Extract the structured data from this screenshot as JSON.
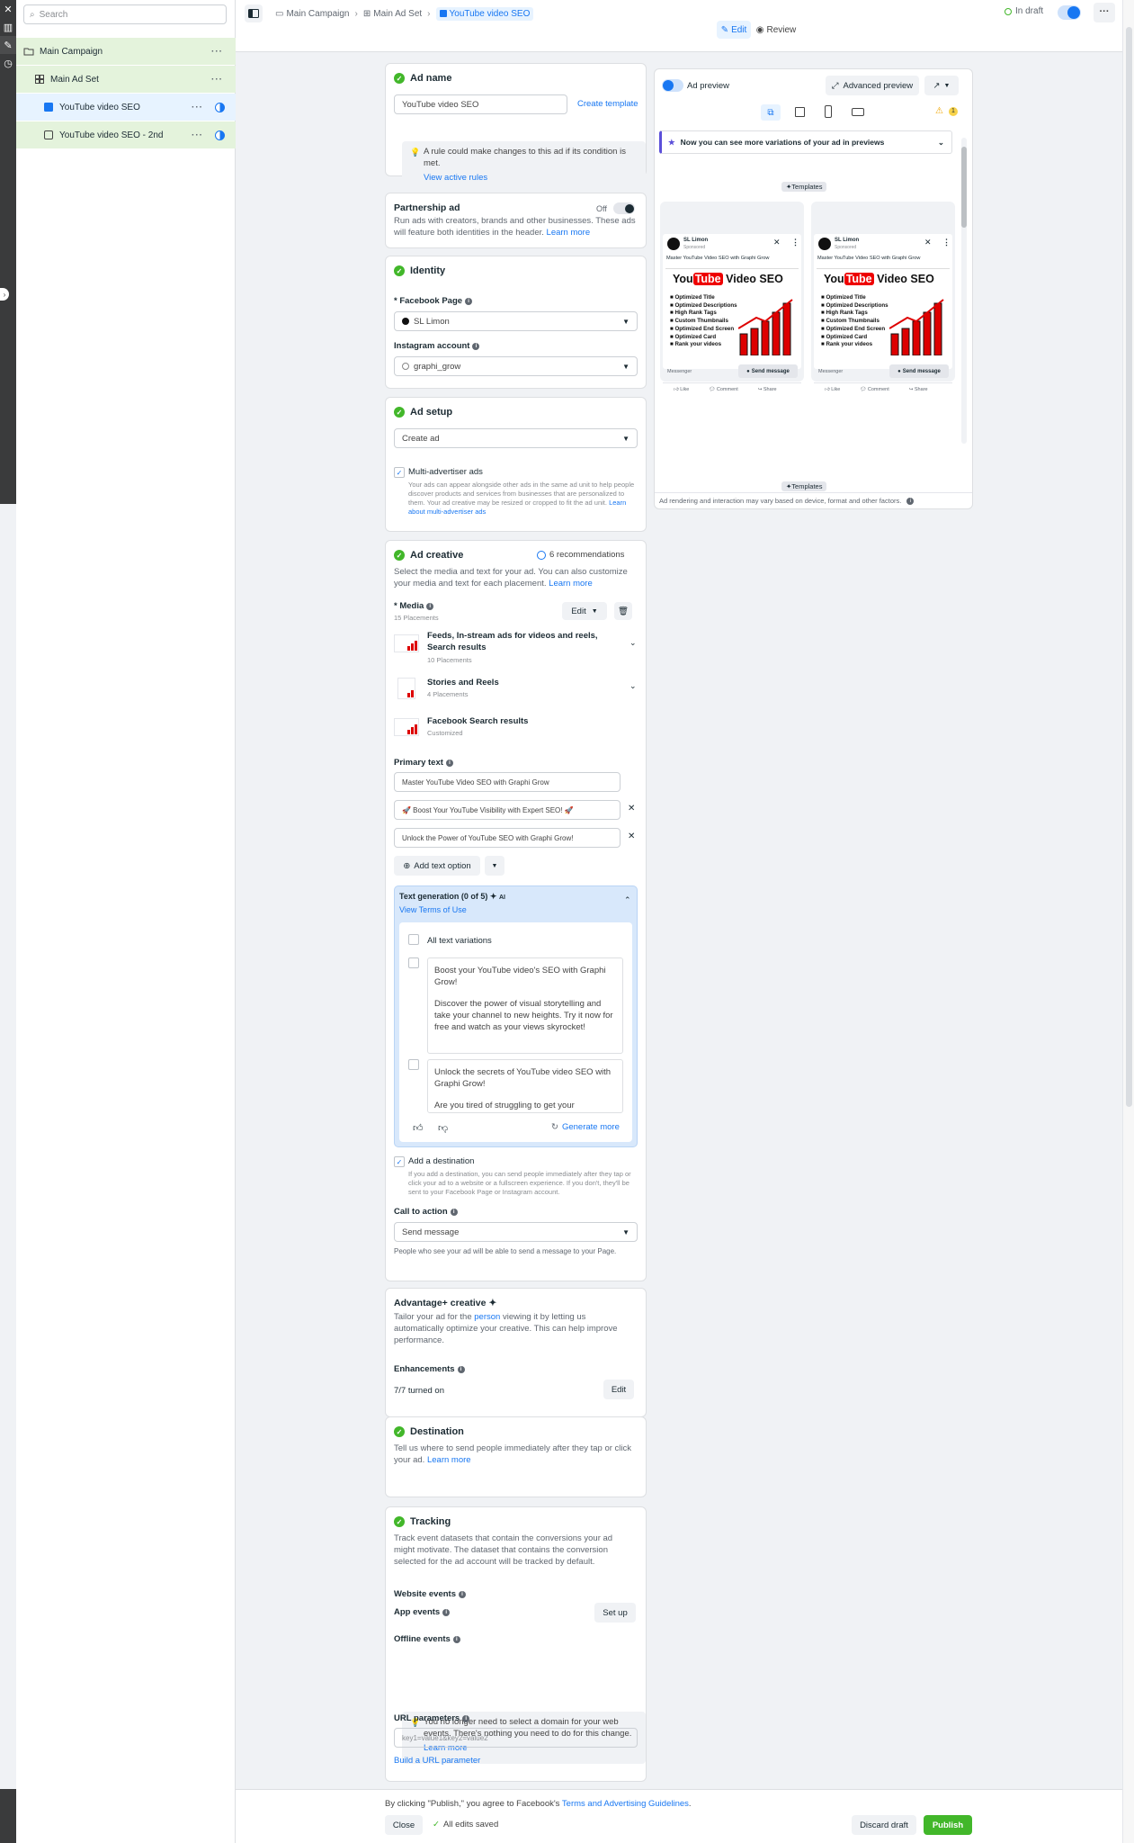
{
  "app": {
    "search_placeholder": "Search"
  },
  "tree": {
    "campaign": "Main Campaign",
    "adset": "Main Ad Set",
    "ad1": "YouTube video SEO",
    "ad2": "YouTube video SEO - 2nd"
  },
  "breadcrumb": {
    "campaign": "Main Campaign",
    "adset": "Main Ad Set",
    "ad": "YouTube video SEO"
  },
  "topbar": {
    "status": "In draft",
    "edit": "Edit",
    "review": "Review"
  },
  "ad_name": {
    "title": "Ad name",
    "value": "YouTube video SEO",
    "create_template": "Create template",
    "rule_note": "A rule could make changes to this ad if its condition is met.",
    "view_rules": "View active rules"
  },
  "partnership": {
    "title": "Partnership ad",
    "toggle": "Off",
    "desc": "Run ads with creators, brands and other businesses. These ads will feature both identities in the header.",
    "learn": "Learn more"
  },
  "identity": {
    "title": "Identity",
    "fb_label": "* Facebook Page",
    "fb_value": "SL Limon",
    "ig_label": "Instagram account",
    "ig_value": "graphi_grow"
  },
  "ad_setup": {
    "title": "Ad setup",
    "select": "Create ad",
    "multi_label": "Multi-advertiser ads",
    "multi_desc": "Your ads can appear alongside other ads in the same ad unit to help people discover products and services from businesses that are personalized to them. Your ad creative may be resized or cropped to fit the ad unit.",
    "multi_link": "Learn about multi-advertiser ads"
  },
  "creative": {
    "title": "Ad creative",
    "recs": "6 recommendations",
    "desc": "Select the media and text for your ad. You can also customize your media and text for each placement.",
    "learn": "Learn more",
    "media_label": "* Media",
    "media_count": "15 Placements",
    "edit": "Edit",
    "placements": [
      {
        "name": "Feeds, In-stream ads for videos and reels, Search results",
        "sub": "10 Placements"
      },
      {
        "name": "Stories and Reels",
        "sub": "4 Placements"
      },
      {
        "name": "Facebook Search results",
        "sub": "Customized"
      }
    ],
    "primary_label": "Primary text",
    "primary_texts": [
      "Master YouTube Video SEO with Graphi Grow",
      "🚀 Boost Your YouTube Visibility with Expert SEO! 🚀",
      "Unlock the Power of YouTube SEO with Graphi Grow!"
    ],
    "add_text": "Add text option",
    "gen_title": "Text generation (0 of 5)",
    "gen_ai": "AI",
    "gen_terms": "View Terms of Use",
    "all_variations": "All text variations",
    "variation1_a": "Boost your YouTube video's SEO with Graphi Grow!",
    "variation1_b": "Discover the power of visual storytelling and take your channel to new heights. Try it now for free and watch as your views skyrocket!",
    "variation2_a": "Unlock the secrets of YouTube video SEO with Graphi Grow!",
    "variation2_b": "Are you tired of struggling to get your",
    "generate": "Generate more",
    "dest_label": "Add a destination",
    "dest_desc": "If you add a destination, you can send people immediately after they tap or click your ad to a website or a fullscreen experience. If you don't, they'll be sent to your Facebook Page or Instagram account.",
    "cta_label": "Call to action",
    "cta_value": "Send message",
    "cta_note": "People who see your ad will be able to send a message to your Page."
  },
  "advantage": {
    "title": "Advantage+ creative",
    "desc_a": "Tailor your ad for the",
    "desc_link": "person",
    "desc_b": "viewing it by letting us automatically optimize your creative. This can help improve performance.",
    "enh_label": "Enhancements",
    "enh_value": "7/7 turned on",
    "edit": "Edit"
  },
  "destination": {
    "title": "Destination",
    "desc": "Tell us where to send people immediately after they tap or click your ad.",
    "learn": "Learn more"
  },
  "tracking": {
    "title": "Tracking",
    "desc": "Track event datasets that contain the conversions your ad might motivate. The dataset that contains the conversion selected for the ad account will be tracked by default.",
    "website": "Website events",
    "app": "App events",
    "setup": "Set up",
    "offline": "Offline events",
    "note": "You no longer need to select a domain for your web events. There's nothing you need to do for this change.",
    "learn": "Learn more",
    "url_label": "URL parameters",
    "url_placeholder": "key1=value1&key2=value2",
    "build": "Build a URL parameter"
  },
  "preview": {
    "label": "Ad preview",
    "advanced": "Advanced preview",
    "warn_count": "1",
    "banner": "Now you can see more variations of your ad in previews",
    "templates": "Templates",
    "templates2": "Templates",
    "disclaimer": "Ad rendering and interaction may vary based on device, format and other factors.",
    "page": "SL Limon",
    "sponsored": "Sponsored",
    "post_text": "Master YouTube Video SEO with Graphi Grow",
    "creative_you": "You",
    "creative_tube": "Tube",
    "creative_rest": "Video SEO",
    "bullets": [
      "Optimized Title",
      "Optimized Descriptions",
      "High Rank Tags",
      "Custom Thumbnails",
      "Optimized End Screen",
      "Optimized Card",
      "Rank your videos"
    ],
    "messenger": "Messenger",
    "send": "Send message",
    "like": "Like",
    "comment": "Comment",
    "share": "Share"
  },
  "footer": {
    "agree_a": "By clicking \"Publish,\" you agree to Facebook's",
    "agree_link": "Terms and Advertising Guidelines",
    "close": "Close",
    "saved": "All edits saved",
    "discard": "Discard draft",
    "publish": "Publish"
  },
  "colors": {
    "accent": "#1877f2",
    "success": "#42b72a",
    "brand_red": "#e00000"
  }
}
